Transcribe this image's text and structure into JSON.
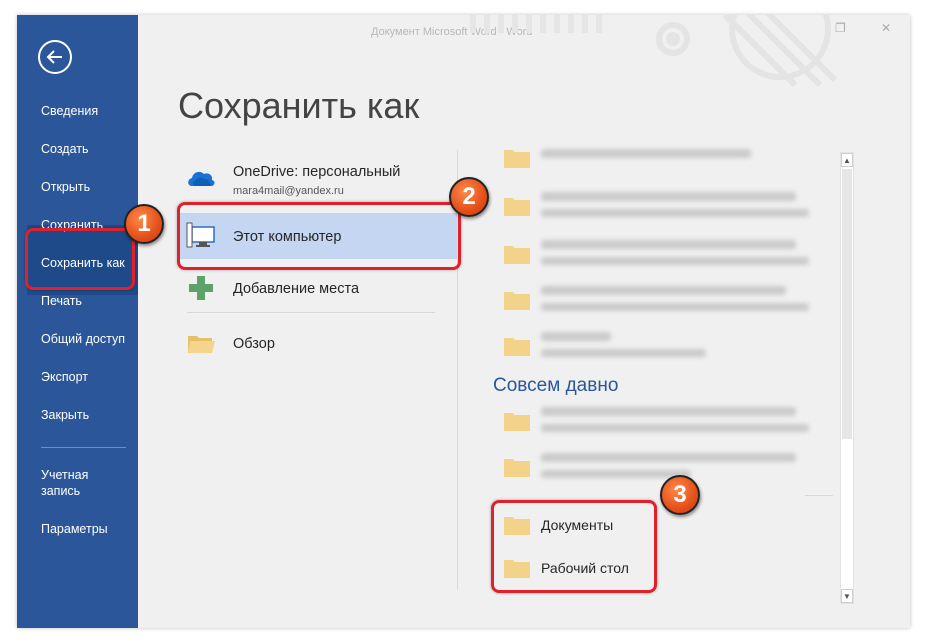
{
  "window": {
    "title": "Документ Microsoft Word - Word"
  },
  "nav": {
    "items": [
      {
        "label": "Сведения"
      },
      {
        "label": "Создать"
      },
      {
        "label": "Открыть"
      },
      {
        "label": "Сохранить"
      },
      {
        "label": "Сохранить как"
      },
      {
        "label": "Печать"
      },
      {
        "label": "Общий доступ"
      },
      {
        "label": "Экспорт"
      },
      {
        "label": "Закрыть"
      },
      {
        "label": "Учетная запись"
      },
      {
        "label": "Параметры"
      }
    ]
  },
  "page": {
    "title": "Сохранить как"
  },
  "locations": {
    "onedrive": {
      "label": "OneDrive: персональный",
      "email": "mara4mail@yandex.ru"
    },
    "this_pc": {
      "label": "Этот компьютер"
    },
    "add_place": {
      "label": "Добавление места"
    },
    "browse": {
      "label": "Обзор"
    }
  },
  "folders": {
    "section_older": "Совсем давно",
    "documents": "Документы",
    "desktop": "Рабочий стол"
  },
  "annotations": {
    "badge1": "1",
    "badge2": "2",
    "badge3": "3",
    "highlight_color": "#e0202a"
  },
  "colors": {
    "nav_bg": "#2b579a",
    "selected_location": "#c5d6f2",
    "section_heading": "#2b579a"
  }
}
